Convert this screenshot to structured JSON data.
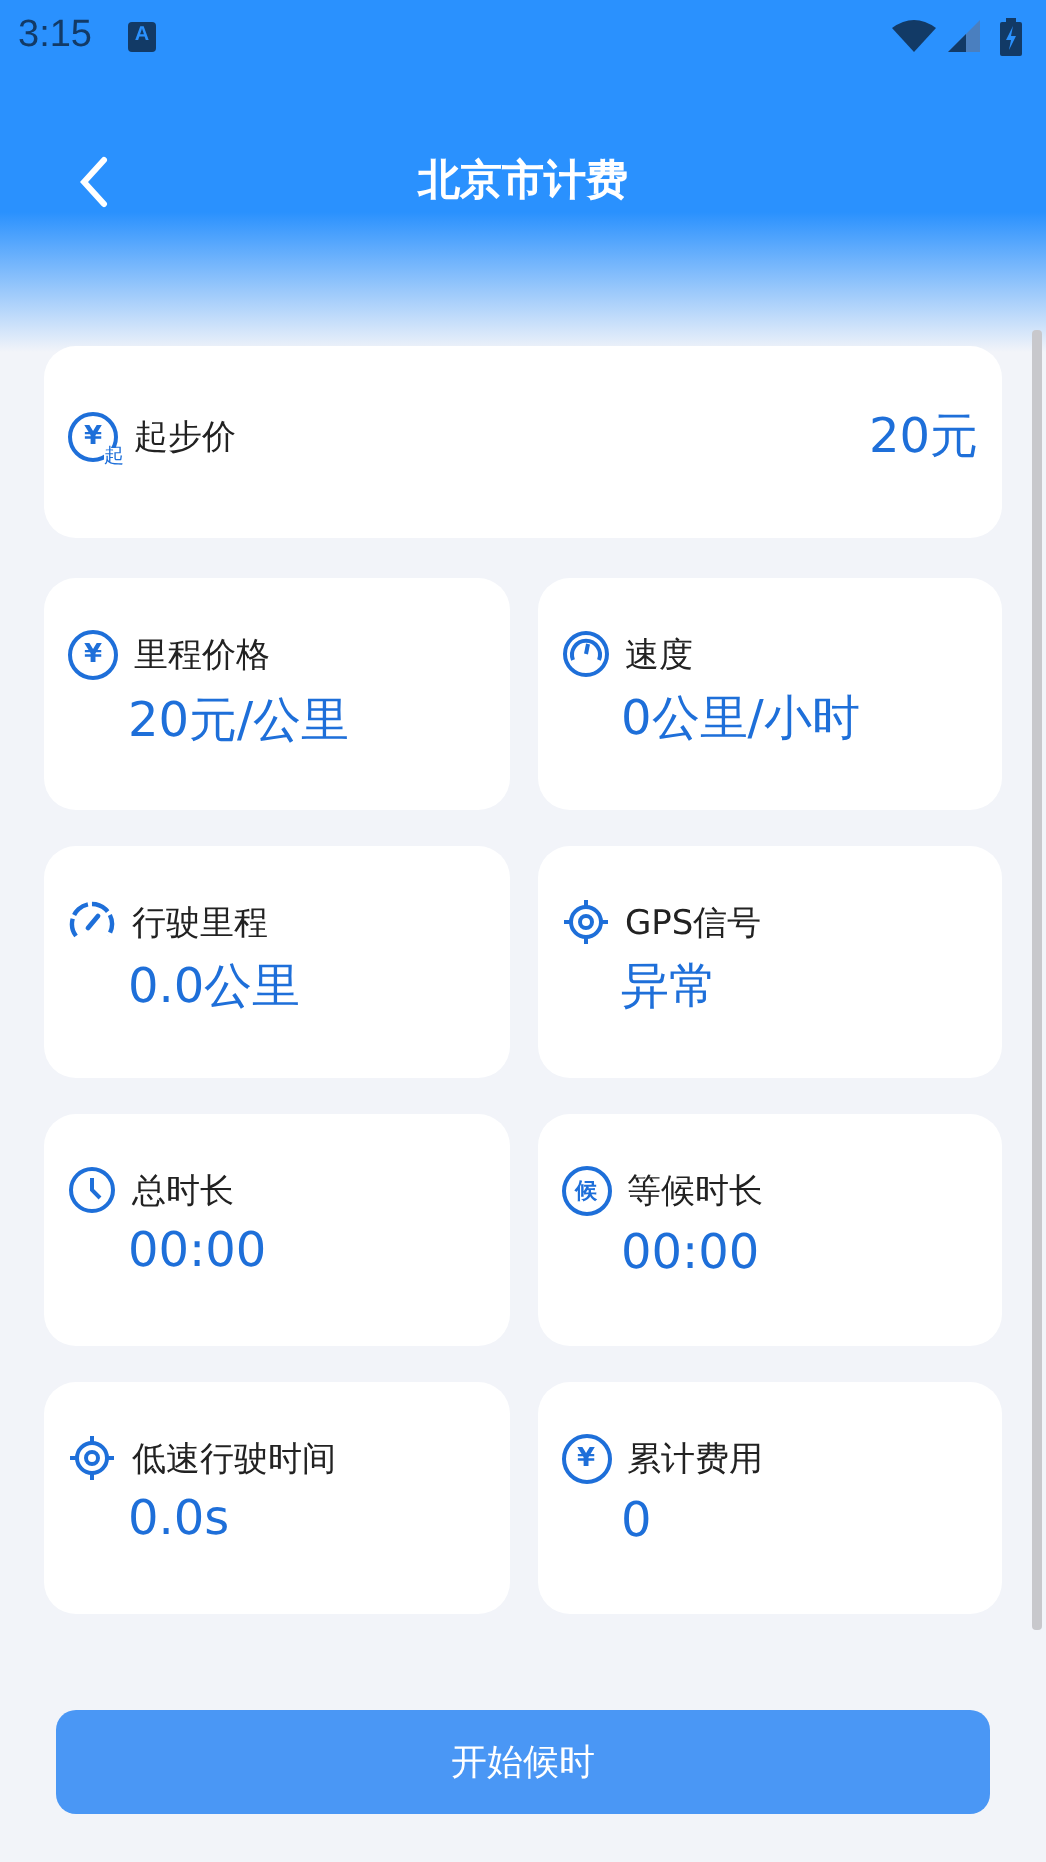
{
  "status_bar": {
    "time": "3:15",
    "notification_icon": "A"
  },
  "header": {
    "title": "北京市计费"
  },
  "base_fare": {
    "label": "起步价",
    "value": "20元",
    "icon": {
      "kind": "yen",
      "glyph": "¥",
      "badge": "起"
    }
  },
  "cards": [
    {
      "label": "里程价格",
      "value": "20元/公里",
      "icon": {
        "kind": "yen",
        "glyph": "¥"
      }
    },
    {
      "label": "速度",
      "value": "0公里/小时",
      "icon": {
        "kind": "gauge"
      }
    },
    {
      "label": "行驶里程",
      "value": "0.0公里",
      "icon": {
        "kind": "speedometer"
      }
    },
    {
      "label": "GPS信号",
      "value": "异常",
      "icon": {
        "kind": "target"
      }
    },
    {
      "label": "总时长",
      "value": "00:00",
      "icon": {
        "kind": "clock"
      }
    },
    {
      "label": "等候时长",
      "value": "00:00",
      "icon": {
        "kind": "char",
        "glyph": "候"
      }
    },
    {
      "label": "低速行驶时间",
      "value": "0.0s",
      "icon": {
        "kind": "target"
      }
    },
    {
      "label": "累计费用",
      "value": "0",
      "icon": {
        "kind": "yen",
        "glyph": "¥"
      }
    }
  ],
  "button": {
    "label": "开始候时"
  }
}
